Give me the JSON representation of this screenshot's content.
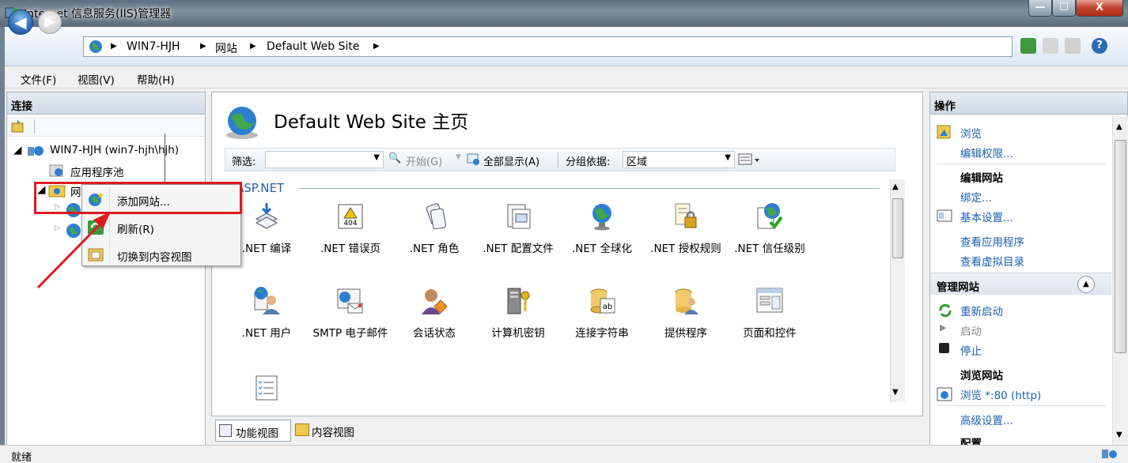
{
  "window": {
    "title": "Internet 信息服务(IIS)管理器",
    "min": "—",
    "max": "☐",
    "close": "X"
  },
  "address": {
    "segments": [
      "WIN7-HJH",
      "网站",
      "Default Web Site"
    ],
    "sep": "▶"
  },
  "menu": [
    "文件(F)",
    "视图(V)",
    "帮助(H)"
  ],
  "left": {
    "title": "连接",
    "tree": {
      "server": "WIN7-HJH (win7-hjh\\hjh)",
      "apppool": "应用程序池",
      "sites": "网站"
    }
  },
  "context_menu": [
    "添加网站...",
    "刷新(R)",
    "切换到内容视图"
  ],
  "center": {
    "title": "Default Web Site 主页",
    "filter_label": "筛选:",
    "start": "开始(G)",
    "show_all": "全部显示(A)",
    "group_label": "分组依据:",
    "group_value": "区域",
    "section": "ASP.NET",
    "row1": [
      ".NET 编译",
      ".NET 错误页",
      ".NET 角色",
      ".NET 配置文件",
      ".NET 全球化",
      ".NET 授权规则",
      ".NET 信任级别"
    ],
    "row2": [
      ".NET 用户",
      "SMTP 电子邮件",
      "会话状态",
      "计算机密钥",
      "连接字符串",
      "提供程序",
      "页面和控件"
    ],
    "icon404": "404"
  },
  "bottom_tabs": [
    "功能视图",
    "内容视图"
  ],
  "right": {
    "title": "操作",
    "items": {
      "browse": "浏览",
      "edit_perm": "编辑权限...",
      "edit_site": "编辑网站",
      "bindings": "绑定...",
      "basic": "基本设置...",
      "view_apps": "查看应用程序",
      "view_vdirs": "查看虚拟目录",
      "manage": "管理网站",
      "restart": "重新启动",
      "start": "启动",
      "stop": "停止",
      "browse_site": "浏览网站",
      "browse_80": "浏览 *:80 (http)",
      "advanced": "高级设置...",
      "config": "配置"
    }
  },
  "status": "就绪"
}
